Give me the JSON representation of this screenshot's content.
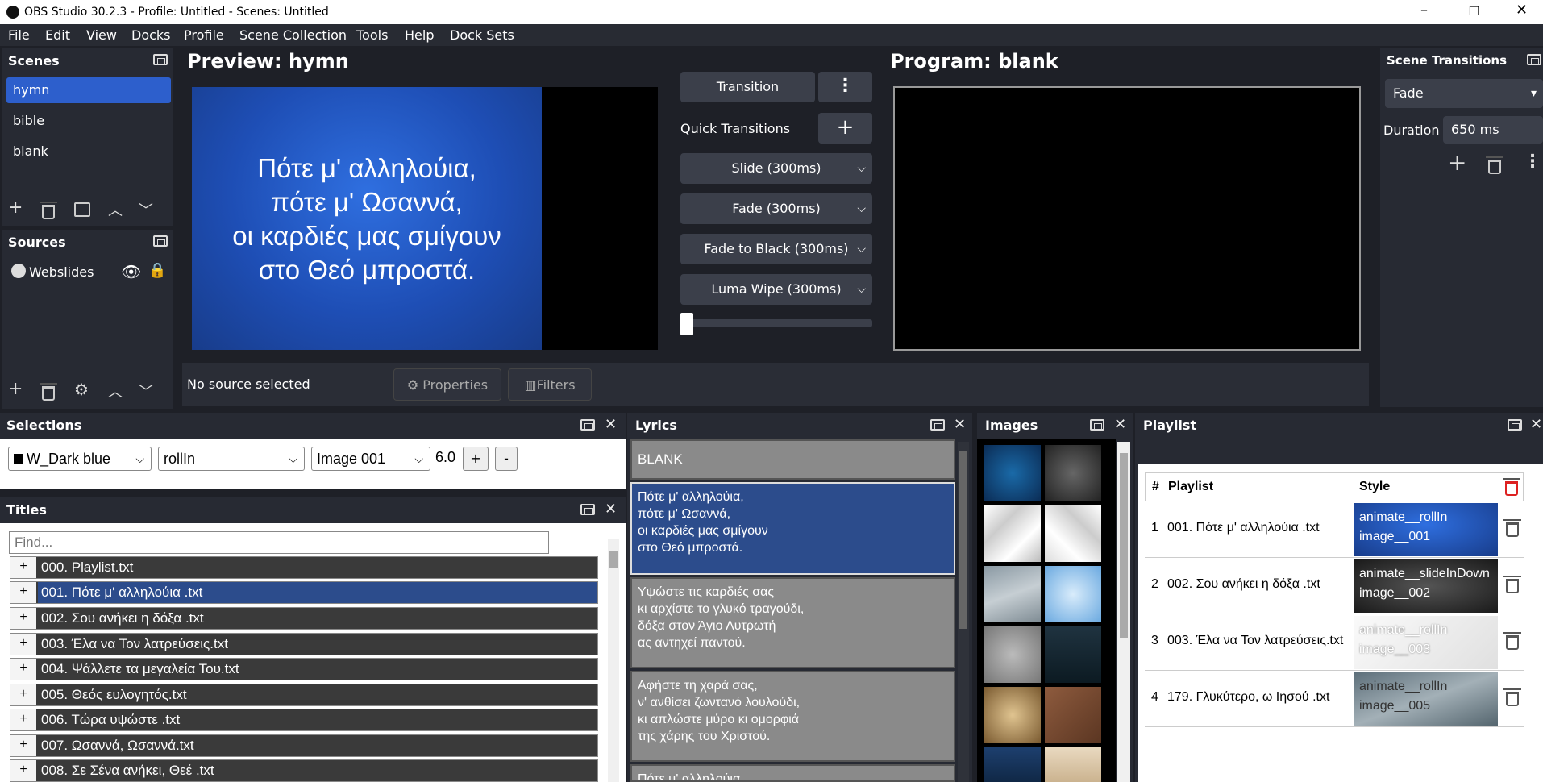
{
  "window": {
    "title": "OBS Studio 30.2.3 - Profile: Untitled - Scenes: Untitled"
  },
  "menu": [
    "File",
    "Edit",
    "View",
    "Docks",
    "Profile",
    "Scene Collection",
    "Tools",
    "Help",
    "Dock Sets"
  ],
  "scenes": {
    "title": "Scenes",
    "items": [
      "hymn",
      "bible",
      "blank"
    ],
    "selected": "hymn"
  },
  "sources": {
    "title": "Sources",
    "items": [
      "Webslides"
    ]
  },
  "preview": {
    "title": "Preview: hymn",
    "text": "Πότε μ' αλληλούια,\nπότε μ' Ωσαννά,\nοι καρδιές μας σμίγουν\nστο Θεό μπροστά."
  },
  "program": {
    "title": "Program: blank"
  },
  "transitions_panel": {
    "transition_label": "Transition",
    "quick_label": "Quick Transitions",
    "quick": [
      "Slide (300ms)",
      "Fade (300ms)",
      "Fade to Black (300ms)",
      "Luma Wipe (300ms)"
    ]
  },
  "scene_transitions": {
    "title": "Scene Transitions",
    "selected": "Fade",
    "duration_label": "Duration",
    "duration": "650 ms"
  },
  "source_bar": {
    "status": "No source selected",
    "properties": "Properties",
    "filters": "Filters"
  },
  "selections": {
    "title": "Selections",
    "style": "W_Dark blue",
    "animation": "rollIn",
    "image": "Image 001",
    "value": "6.0",
    "plus": "+",
    "minus": "-"
  },
  "titles": {
    "title": "Titles",
    "find_placeholder": "Find...",
    "items": [
      "000. Playlist.txt",
      "001. Πότε μ' αλληλούια .txt",
      "002. Σου ανήκει η δόξα .txt",
      "003. Έλα να Τον λατρεύσεις.txt",
      "004. Ψάλλετε τα μεγαλεία Του.txt",
      "005. Θεός ευλογητός.txt",
      "006. Τώρα υψώστε .txt",
      "007. Ωσαννά, Ωσαννά.txt",
      "008. Σε Σένα ανήκει, Θεέ .txt"
    ],
    "selected": 1
  },
  "lyrics": {
    "title": "Lyrics",
    "blank": "BLANK",
    "verses": [
      "Πότε μ' αλληλούια,\nπότε μ' Ωσαννά,\nοι καρδιές μας σμίγουν\nστο Θεό μπροστά.",
      "Υψώστε τις καρδιές σας\nκι αρχίστε το γλυκό τραγούδι,\nδόξα στον Άγιο Λυτρωτή\nας αντηχεί παντού.",
      "Αφήστε τη χαρά σας,\nν' ανθίσει ζωντανό λουλούδι,\nκι απλώστε μύρο κι ομορφιά\nτης χάρης του Χριστού.",
      "Πότε μ' αλληλούια,"
    ]
  },
  "images": {
    "title": "Images"
  },
  "playlist": {
    "title": "Playlist",
    "headers": [
      "#",
      "Playlist",
      "Style"
    ],
    "rows": [
      {
        "n": "1",
        "file": "001. Πότε μ' αλληλούια .txt",
        "style1": "animate__rollIn",
        "style2": "image__001"
      },
      {
        "n": "2",
        "file": "002. Σου ανήκει η δόξα .txt",
        "style1": "animate__slideInDown",
        "style2": "image__002"
      },
      {
        "n": "3",
        "file": "003. Έλα να Τον λατρεύσεις.txt",
        "style1": "animate__rollIn",
        "style2": "image__003"
      },
      {
        "n": "4",
        "file": "179. Γλυκύτερο, ω Ιησού .txt",
        "style1": "animate__rollIn",
        "style2": "image__005"
      }
    ]
  },
  "colors": {
    "accent": "#2d5fcc",
    "panel": "#272a33",
    "bg": "#1e2027",
    "selected_title": "#2c4c8c"
  }
}
